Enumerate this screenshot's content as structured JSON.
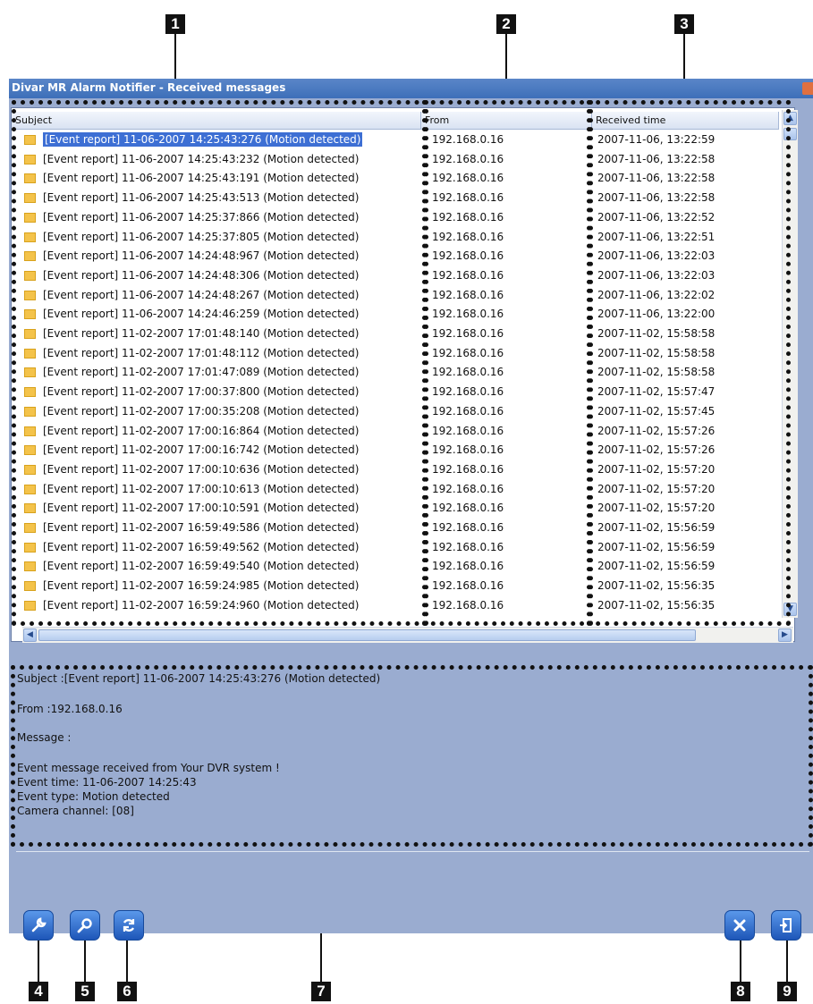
{
  "window": {
    "title": "Divar MR Alarm Notifier - Received messages"
  },
  "callouts": [
    "1",
    "2",
    "3",
    "4",
    "5",
    "6",
    "7",
    "8",
    "9"
  ],
  "columns": {
    "subject": "Subject",
    "from": "From",
    "received": "Received time"
  },
  "rows": [
    {
      "subject": "[Event report] 11-06-2007 14:25:43:276 (Motion detected)",
      "from": "192.168.0.16",
      "received": "2007-11-06, 13:22:59",
      "selected": true
    },
    {
      "subject": "[Event report] 11-06-2007 14:25:43:232 (Motion detected)",
      "from": "192.168.0.16",
      "received": "2007-11-06, 13:22:58"
    },
    {
      "subject": "[Event report] 11-06-2007 14:25:43:191 (Motion detected)",
      "from": "192.168.0.16",
      "received": "2007-11-06, 13:22:58"
    },
    {
      "subject": "[Event report] 11-06-2007 14:25:43:513 (Motion detected)",
      "from": "192.168.0.16",
      "received": "2007-11-06, 13:22:58"
    },
    {
      "subject": "[Event report] 11-06-2007 14:25:37:866 (Motion detected)",
      "from": "192.168.0.16",
      "received": "2007-11-06, 13:22:52"
    },
    {
      "subject": "[Event report] 11-06-2007 14:25:37:805 (Motion detected)",
      "from": "192.168.0.16",
      "received": "2007-11-06, 13:22:51"
    },
    {
      "subject": "[Event report] 11-06-2007 14:24:48:967 (Motion detected)",
      "from": "192.168.0.16",
      "received": "2007-11-06, 13:22:03"
    },
    {
      "subject": "[Event report] 11-06-2007 14:24:48:306 (Motion detected)",
      "from": "192.168.0.16",
      "received": "2007-11-06, 13:22:03"
    },
    {
      "subject": "[Event report] 11-06-2007 14:24:48:267 (Motion detected)",
      "from": "192.168.0.16",
      "received": "2007-11-06, 13:22:02"
    },
    {
      "subject": "[Event report] 11-06-2007 14:24:46:259 (Motion detected)",
      "from": "192.168.0.16",
      "received": "2007-11-06, 13:22:00"
    },
    {
      "subject": "[Event report] 11-02-2007 17:01:48:140 (Motion detected)",
      "from": "192.168.0.16",
      "received": "2007-11-02, 15:58:58"
    },
    {
      "subject": "[Event report] 11-02-2007 17:01:48:112 (Motion detected)",
      "from": "192.168.0.16",
      "received": "2007-11-02, 15:58:58"
    },
    {
      "subject": "[Event report] 11-02-2007 17:01:47:089 (Motion detected)",
      "from": "192.168.0.16",
      "received": "2007-11-02, 15:58:58"
    },
    {
      "subject": "[Event report] 11-02-2007 17:00:37:800 (Motion detected)",
      "from": "192.168.0.16",
      "received": "2007-11-02, 15:57:47"
    },
    {
      "subject": "[Event report] 11-02-2007 17:00:35:208 (Motion detected)",
      "from": "192.168.0.16",
      "received": "2007-11-02, 15:57:45"
    },
    {
      "subject": "[Event report] 11-02-2007 17:00:16:864 (Motion detected)",
      "from": "192.168.0.16",
      "received": "2007-11-02, 15:57:26"
    },
    {
      "subject": "[Event report] 11-02-2007 17:00:16:742 (Motion detected)",
      "from": "192.168.0.16",
      "received": "2007-11-02, 15:57:26"
    },
    {
      "subject": "[Event report] 11-02-2007 17:00:10:636 (Motion detected)",
      "from": "192.168.0.16",
      "received": "2007-11-02, 15:57:20"
    },
    {
      "subject": "[Event report] 11-02-2007 17:00:10:613 (Motion detected)",
      "from": "192.168.0.16",
      "received": "2007-11-02, 15:57:20"
    },
    {
      "subject": "[Event report] 11-02-2007 17:00:10:591 (Motion detected)",
      "from": "192.168.0.16",
      "received": "2007-11-02, 15:57:20"
    },
    {
      "subject": "[Event report] 11-02-2007 16:59:49:586 (Motion detected)",
      "from": "192.168.0.16",
      "received": "2007-11-02, 15:56:59"
    },
    {
      "subject": "[Event report] 11-02-2007 16:59:49:562 (Motion detected)",
      "from": "192.168.0.16",
      "received": "2007-11-02, 15:56:59"
    },
    {
      "subject": "[Event report] 11-02-2007 16:59:49:540 (Motion detected)",
      "from": "192.168.0.16",
      "received": "2007-11-02, 15:56:59"
    },
    {
      "subject": "[Event report] 11-02-2007 16:59:24:985 (Motion detected)",
      "from": "192.168.0.16",
      "received": "2007-11-02, 15:56:35"
    },
    {
      "subject": "[Event report] 11-02-2007 16:59:24:960 (Motion detected)",
      "from": "192.168.0.16",
      "received": "2007-11-02, 15:56:35"
    }
  ],
  "message": {
    "subject_line": "Subject :[Event report] 11-06-2007 14:25:43:276 (Motion detected)",
    "from_line": "From :192.168.0.16",
    "message_label": "Message :",
    "body": [
      "Event message received from Your DVR system !",
      "Event time: 11-06-2007 14:25:43",
      "Event type: Motion detected",
      "Camera channel: [08]"
    ]
  },
  "toolbar": {
    "settings_icon": "wrench-icon",
    "search_icon": "magnifier-icon",
    "refresh_icon": "refresh-icon",
    "delete_icon": "close-icon",
    "exit_icon": "exit-door-icon"
  },
  "colors": {
    "window_bg": "#9aacd0",
    "titlebar": "#3d6fb9",
    "selection": "#3d6fd4",
    "button": "#1e56b8"
  }
}
